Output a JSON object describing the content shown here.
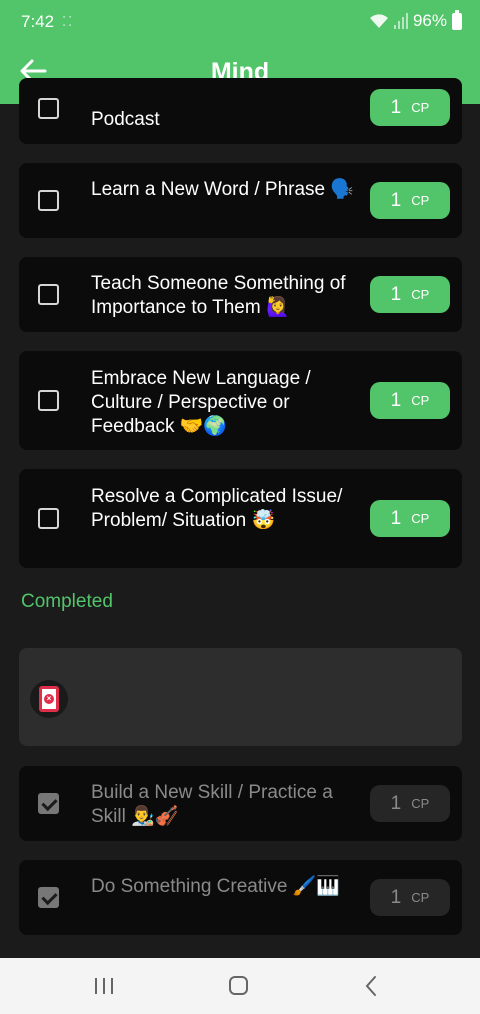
{
  "status": {
    "time": "7:42",
    "battery": "96%"
  },
  "header": {
    "title": "Mind"
  },
  "tasks": [
    {
      "label": "Podcast",
      "cp_value": "1",
      "cp_unit": "CP",
      "checked": false
    },
    {
      "label": "Learn a New Word / Phrase 🗣️",
      "cp_value": "1",
      "cp_unit": "CP",
      "checked": false
    },
    {
      "label": "Teach Someone Something of Importance to Them 🙋‍♀️",
      "cp_value": "1",
      "cp_unit": "CP",
      "checked": false
    },
    {
      "label": "Embrace New Language / Culture / Perspective or Feedback 🤝🌍",
      "cp_value": "1",
      "cp_unit": "CP",
      "checked": false
    },
    {
      "label": "Resolve a Complicated Issue/ Problem/ Situation 🤯",
      "cp_value": "1",
      "cp_unit": "CP",
      "checked": false
    }
  ],
  "completed_heading": "Completed",
  "completed_tasks": [
    {
      "label": "Build a New Skill / Practice a Skill 👨‍🎨🎻",
      "cp_value": "1",
      "cp_unit": "CP",
      "checked": true
    },
    {
      "label": "Do Something Creative 🖌️🎹",
      "cp_value": "1",
      "cp_unit": "CP",
      "checked": true
    }
  ],
  "colors": {
    "accent": "#52c46a",
    "background": "#1b1b1b",
    "card": "#0b0b0b"
  },
  "icons": {
    "back": "arrow-left-icon",
    "empty": "clipboard-x-icon"
  }
}
